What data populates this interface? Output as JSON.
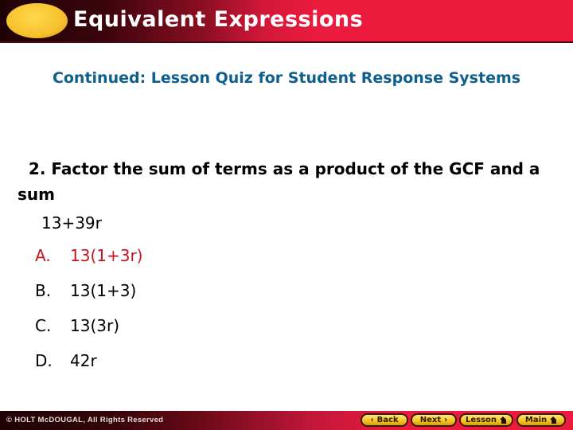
{
  "header": {
    "title": "Equivalent Expressions",
    "accent_color": "#ea1b3d",
    "oval_color": "#f6c12c"
  },
  "subtitle": "Continued:  Lesson Quiz for Student Response Systems",
  "question": {
    "text": "  2. Factor the sum of terms as a product of the GCF and a sum",
    "expression": "13+39r",
    "choices": [
      {
        "letter": "A.",
        "text": "13(1+3r)",
        "correct": true
      },
      {
        "letter": "B.",
        "text": "13(1+3)",
        "correct": false
      },
      {
        "letter": "C.",
        "text": "13(3r)",
        "correct": false
      },
      {
        "letter": "D.",
        "text": "42r",
        "correct": false
      }
    ],
    "correct_color": "#c8131e"
  },
  "footer": {
    "copyright": "© HOLT McDOUGAL, All Rights Reserved",
    "nav": {
      "back": {
        "label": "Back",
        "icon": "chevron-left-icon",
        "glyph": "‹"
      },
      "next": {
        "label": "Next",
        "icon": "chevron-right-icon",
        "glyph": "›"
      },
      "lesson": {
        "label": "Lesson",
        "icon": "home-icon"
      },
      "main": {
        "label": "Main",
        "icon": "home-icon"
      }
    }
  }
}
